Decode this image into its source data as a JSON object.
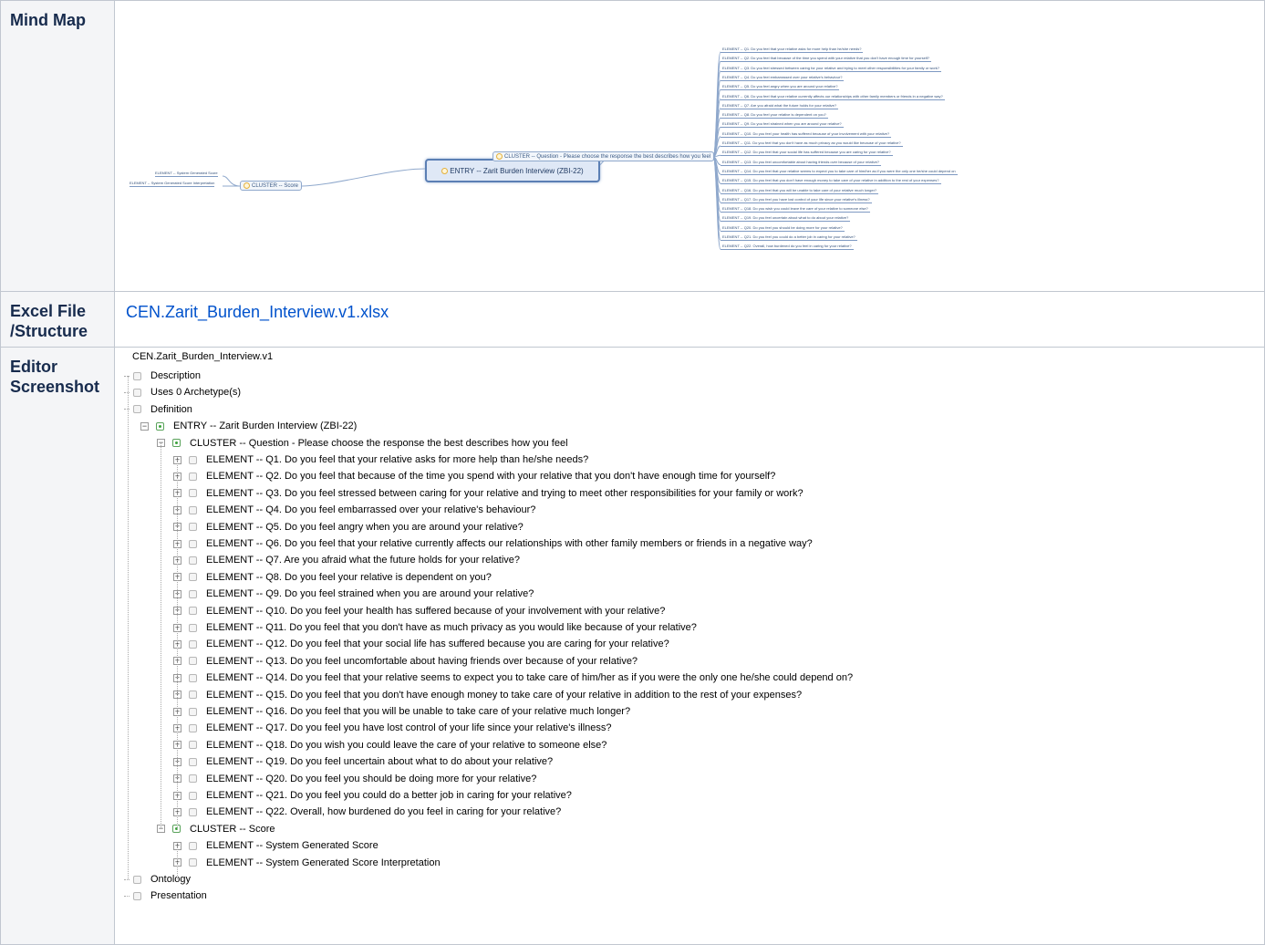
{
  "rows": {
    "mindmap": {
      "header": "Mind Map"
    },
    "excel": {
      "header": "Excel File /Structure",
      "link_text": "CEN.Zarit_Burden_Interview.v1.xlsx"
    },
    "editor": {
      "header": "Editor Screenshot"
    }
  },
  "mindmap": {
    "root": "ENTRY -- Zarit Burden Interview (ZBI-22)",
    "cluster_question": "CLUSTER -- Question - Please choose the response the best describes how you feel",
    "cluster_score": "CLUSTER -- Score",
    "score_elements": [
      "ELEMENT -- System Generated Score",
      "ELEMENT -- System Generated Score Interpretation"
    ],
    "question_elements": [
      "ELEMENT -- Q1. Do you feel that your relative asks for more help than he/she needs?",
      "ELEMENT -- Q2. Do you feel that because of the time you spend with your relative that you don't have enough time for yourself?",
      "ELEMENT -- Q3. Do you feel stressed between caring for your relative and trying to meet other responsibilities for your family or work?",
      "ELEMENT -- Q4. Do you feel embarrassed over your relative's behaviour?",
      "ELEMENT -- Q5. Do you feel angry when you are around your relative?",
      "ELEMENT -- Q6. Do you feel that your relative currently affects our relationships with other family members or friends in a negative way?",
      "ELEMENT -- Q7. Are you afraid what the future holds for your relative?",
      "ELEMENT -- Q8. Do you feel your relative is dependent on you?",
      "ELEMENT -- Q9. Do you feel strained when you are around your relative?",
      "ELEMENT -- Q10. Do you feel your health has suffered because of your involvement with your relative?",
      "ELEMENT -- Q11. Do you feel that you don't have as much privacy as you would like because of your relative?",
      "ELEMENT -- Q12. Do you feel that your social life has suffered because you are caring for your relative?",
      "ELEMENT -- Q13. Do you feel uncomfortable about having friends over because of your relative?",
      "ELEMENT -- Q14. Do you feel that your relative seems to expect you to take care of him/her as if you were the only one he/she could depend on",
      "ELEMENT -- Q15. Do you feel that you don't have enough money to take care of your relative in addition to the rest of your expenses?",
      "ELEMENT -- Q16. Do you feel that you will be unable to take care of your relative much longer?",
      "ELEMENT -- Q17. Do you feel you have lost control of your life since your relative's illness?",
      "ELEMENT -- Q18. Do you wish you could leave the care of your relative to someone else?",
      "ELEMENT -- Q19. Do you feel uncertain about what to do about your relative?",
      "ELEMENT -- Q20. Do you feel you should be doing more for your relative?",
      "ELEMENT -- Q21. Do you feel you could do a better job in caring for your relative?",
      "ELEMENT -- Q22. Overall, how burdened do you feel in caring for your relative?"
    ]
  },
  "editor": {
    "title": "CEN.Zarit_Burden_Interview.v1",
    "top_items": [
      "Description",
      "Uses 0 Archetype(s)",
      "Definition"
    ],
    "entry": "ENTRY -- Zarit Burden Interview (ZBI-22)",
    "cluster_question": "CLUSTER -- Question - Please choose the response the best describes how you feel",
    "question_elements": [
      "ELEMENT -- Q1. Do you feel that your relative asks for more help than he/she needs?",
      "ELEMENT -- Q2. Do you feel that because of the time you spend with your relative that you don't have enough time for yourself?",
      "ELEMENT -- Q3. Do you feel stressed between caring for your relative and trying to meet other responsibilities for your family or work?",
      "ELEMENT -- Q4. Do you feel embarrassed over your relative's behaviour?",
      "ELEMENT -- Q5. Do you feel angry when you are around your relative?",
      "ELEMENT -- Q6. Do you feel that your relative currently affects our relationships with other family members or friends in a negative way?",
      "ELEMENT -- Q7. Are you afraid what the future holds for your relative?",
      "ELEMENT -- Q8. Do you feel your relative is dependent on you?",
      "ELEMENT -- Q9. Do you feel strained when you are around your relative?",
      "ELEMENT -- Q10. Do you feel your health has suffered because of your involvement with your relative?",
      "ELEMENT -- Q11. Do you feel that you don't have as much privacy as you would like because of your relative?",
      "ELEMENT -- Q12. Do you feel that your social life has suffered because you are caring for your relative?",
      "ELEMENT -- Q13. Do you feel uncomfortable about having friends over because of your relative?",
      "ELEMENT -- Q14. Do you feel that your relative seems to expect you to take care of him/her as if you were the only one he/she could depend on?",
      "ELEMENT -- Q15. Do you feel that you don't have enough money to take care of your relative in addition to the rest of your expenses?",
      "ELEMENT -- Q16. Do you feel that you will be unable to take care of your relative much longer?",
      "ELEMENT -- Q17. Do you feel you have lost control of your life since your relative's illness?",
      "ELEMENT -- Q18. Do you wish you could leave the care of your relative to someone else?",
      "ELEMENT -- Q19. Do you feel uncertain about what to do about your relative?",
      "ELEMENT -- Q20. Do you feel you should be doing more for your relative?",
      "ELEMENT -- Q21. Do you feel you could do a better job in caring for your relative?",
      "ELEMENT -- Q22. Overall, how burdened do you feel in caring for your relative?"
    ],
    "cluster_score": "CLUSTER -- Score",
    "score_elements": [
      "ELEMENT -- System Generated Score",
      "ELEMENT -- System Generated Score Interpretation"
    ],
    "bottom_items": [
      "Ontology",
      "Presentation"
    ]
  }
}
